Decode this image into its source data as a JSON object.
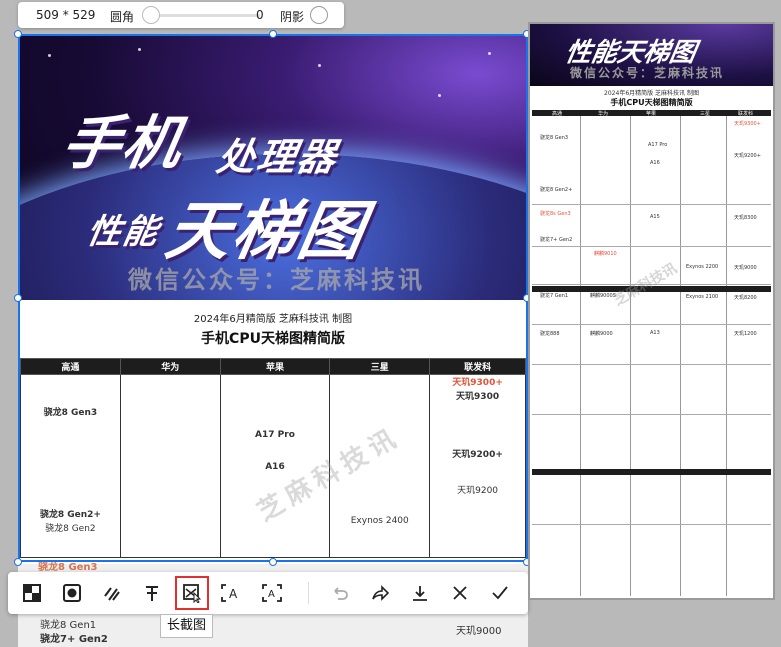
{
  "size_bar": {
    "dimensions": "509 * 529",
    "radius_label": "圆角",
    "radius_value": "0",
    "shadow_label": "阴影"
  },
  "banner": {
    "line1": "手机",
    "line2": "处理器",
    "line3": "性能",
    "line4": "天梯图",
    "watermark": "微信公众号：芝麻科技讯"
  },
  "doc": {
    "subline": "2024年6月精简版 芝麻科技讯 制图",
    "title": "手机CPU天梯图精简版",
    "diag_watermark": "芝麻科技讯"
  },
  "table": {
    "headers": [
      "高通",
      "华为",
      "苹果",
      "三星",
      "联发科"
    ],
    "qualcomm": [
      "骁龙8 Gen3",
      "骁龙8 Gen2+",
      "骁龙8 Gen2"
    ],
    "apple": [
      "A17 Pro",
      "A16"
    ],
    "samsung": [
      "Exynos 2400"
    ],
    "mediatek": [
      "天玑9300+",
      "天玑9300",
      "天玑9200+",
      "天玑9200"
    ]
  },
  "below": {
    "q1": "骁龙8 Gen3",
    "q2": "骁龙8 Gen1",
    "q3": "骁龙7+ Gen2",
    "m1": "天玑9000"
  },
  "toolbar": {
    "tooltip": "长截图"
  },
  "preview": {
    "title": "性能天梯图",
    "watermark": "微信公众号：芝麻科技讯",
    "subline": "2024年6月精简版 芝麻科技讯 制图",
    "doc_title": "手机CPU天梯图精简版",
    "headers": [
      "高通",
      "华为",
      "苹果",
      "三星",
      "联发科"
    ],
    "rows": [
      {
        "q": "骁龙8 Gen3",
        "a": "A17 Pro",
        "m": "天玑9300+"
      },
      {
        "q": "骁龙8 Gen2+",
        "a": "A16",
        "m": "天玑9200+"
      },
      {
        "q": "骁龙8s Gen3",
        "a": "A15",
        "m": "天玑8300"
      },
      {
        "q": "骁龙7+ Gen2",
        "h": "麒麟9010",
        "s": "Exynos 2200",
        "m": "天玑9000"
      },
      {
        "q": "骁龙7 Gen1",
        "h": "麒麟9000S",
        "s": "Exynos 2100",
        "m": "天玑8200"
      },
      {
        "q": "骁龙888",
        "h": "麒麟9000",
        "a": "A13",
        "m": "天玑1200"
      }
    ],
    "wm2": "芝麻科技讯"
  }
}
